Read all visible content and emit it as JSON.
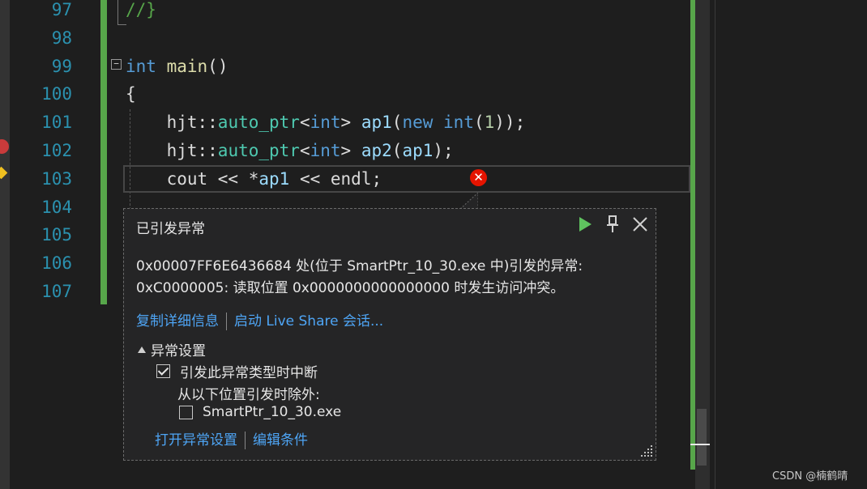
{
  "editor": {
    "line_numbers": [
      "97",
      "98",
      "99",
      "100",
      "101",
      "102",
      "103",
      "104",
      "105",
      "106",
      "107"
    ],
    "fold_symbol": "−",
    "code_lines": [
      {
        "tokens": [
          {
            "t": "//}",
            "c": "cm"
          }
        ]
      },
      {
        "tokens": []
      },
      {
        "tokens": [
          {
            "t": "int",
            "c": "kw"
          },
          {
            "t": " ",
            "c": "pl"
          },
          {
            "t": "main",
            "c": "fn"
          },
          {
            "t": "()",
            "c": "pl"
          }
        ]
      },
      {
        "tokens": [
          {
            "t": "{",
            "c": "pl"
          }
        ]
      },
      {
        "tokens": [
          {
            "t": "    hjt::",
            "c": "pl"
          },
          {
            "t": "auto_ptr",
            "c": "ty"
          },
          {
            "t": "<",
            "c": "pl"
          },
          {
            "t": "int",
            "c": "kw"
          },
          {
            "t": "> ",
            "c": "pl"
          },
          {
            "t": "ap1",
            "c": "id"
          },
          {
            "t": "(",
            "c": "pl"
          },
          {
            "t": "new",
            "c": "kw"
          },
          {
            "t": " ",
            "c": "pl"
          },
          {
            "t": "int",
            "c": "kw"
          },
          {
            "t": "(",
            "c": "pl"
          },
          {
            "t": "1",
            "c": "nm"
          },
          {
            "t": "));",
            "c": "pl"
          }
        ]
      },
      {
        "tokens": [
          {
            "t": "    hjt::",
            "c": "pl"
          },
          {
            "t": "auto_ptr",
            "c": "ty"
          },
          {
            "t": "<",
            "c": "pl"
          },
          {
            "t": "int",
            "c": "kw"
          },
          {
            "t": "> ",
            "c": "pl"
          },
          {
            "t": "ap2",
            "c": "id"
          },
          {
            "t": "(",
            "c": "pl"
          },
          {
            "t": "ap1",
            "c": "id"
          },
          {
            "t": ");",
            "c": "pl"
          }
        ]
      },
      {
        "tokens": [
          {
            "t": "    cout << *",
            "c": "pl"
          },
          {
            "t": "ap1",
            "c": "id"
          },
          {
            "t": " << endl;",
            "c": "pl"
          }
        ]
      },
      {
        "tokens": []
      },
      {
        "tokens": []
      },
      {
        "tokens": []
      },
      {
        "tokens": []
      }
    ],
    "error_glyph": "✕"
  },
  "popup": {
    "title": "已引发异常",
    "message_line1": "0x00007FF6E6436684 处(位于 SmartPtr_10_30.exe 中)引发的异常:",
    "message_line2": "0xC0000005: 读取位置 0x0000000000000000 时发生访问冲突。",
    "link_copy": "复制详细信息",
    "link_liveshare": "启动 Live Share 会话...",
    "exception_settings_header": "异常设置",
    "break_when_thrown_label": "引发此异常类型时中断",
    "break_when_thrown_checked": true,
    "except_from_label": "从以下位置引发时除外:",
    "module_label": "SmartPtr_10_30.exe",
    "module_checked": false,
    "link_open_settings": "打开异常设置",
    "link_edit_conditions": "编辑条件",
    "icons": [
      "continue-icon",
      "pin-icon",
      "close-icon"
    ]
  },
  "watermark": "CSDN @楠鹤晴",
  "colors": {
    "accent_green": "#57a64a",
    "error_red": "#e51400",
    "link_blue": "#4ea5f5",
    "continue_green": "#5fc35f"
  }
}
